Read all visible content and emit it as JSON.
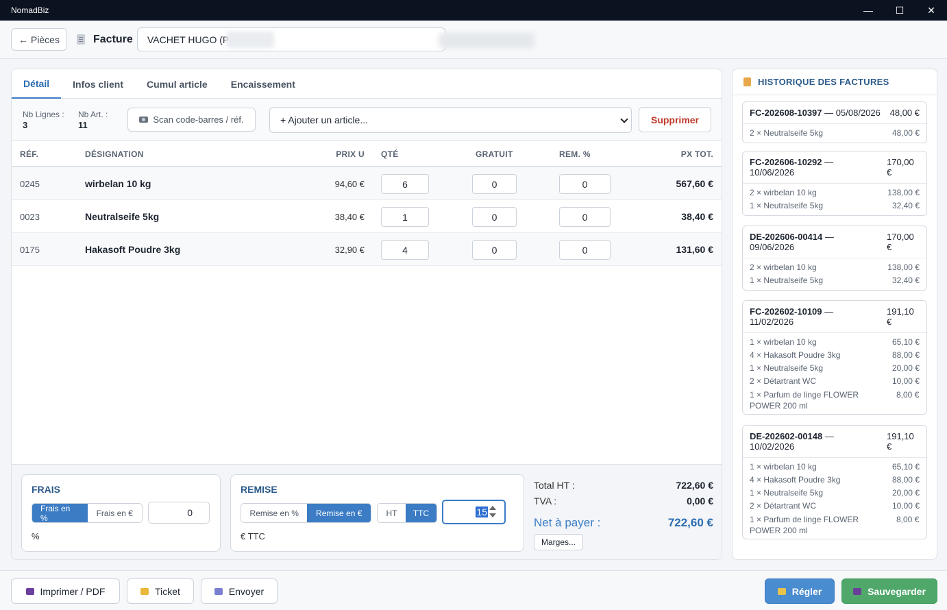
{
  "window": {
    "title": "NomadBiz",
    "minimize": "—",
    "maximize": "☐",
    "close": "✕"
  },
  "header": {
    "back_label": "← Pièces",
    "doc_type": "Facture",
    "client_value": "VACHET HUGO (PE"
  },
  "tabs": [
    "Détail",
    "Infos client",
    "Cumul article",
    "Encaissement"
  ],
  "toolbar": {
    "nb_lignes_label": "Nb Lignes :",
    "nb_lignes": "3",
    "nb_art_label": "Nb Art. :",
    "nb_art": "11",
    "scan_label": "Scan code-barres / réf.",
    "add_label": "+  Ajouter un article...",
    "delete_label": "Supprimer"
  },
  "table": {
    "headers": {
      "ref": "RÉF.",
      "designation": "DÉSIGNATION",
      "prix_u": "PRIX U",
      "qte": "QTÉ",
      "gratuit": "GRATUIT",
      "rem": "REM. %",
      "total": "PX TOT."
    },
    "rows": [
      {
        "ref": "0245",
        "designation": "wirbelan 10 kg",
        "prix_u": "94,60 €",
        "qte": "6",
        "gratuit": "0",
        "rem": "0",
        "total": "567,60 €"
      },
      {
        "ref": "0023",
        "designation": "Neutralseife 5kg",
        "prix_u": "38,40 €",
        "qte": "1",
        "gratuit": "0",
        "rem": "0",
        "total": "38,40 €"
      },
      {
        "ref": "0175",
        "designation": "Hakasoft Poudre 3kg",
        "prix_u": "32,90 €",
        "qte": "4",
        "gratuit": "0",
        "rem": "0",
        "total": "131,60 €"
      }
    ]
  },
  "frais": {
    "title": "FRAIS",
    "opt_pct": "Frais en %",
    "opt_eur": "Frais en €",
    "selected": "Frais en %",
    "value": "0",
    "unit": "%"
  },
  "remise": {
    "title": "REMISE",
    "opt_pct": "Remise en %",
    "opt_eur": "Remise en €",
    "selected": "Remise en €",
    "opt_ht": "HT",
    "opt_ttc": "TTC",
    "selected_tax": "TTC",
    "value": "15",
    "unit": "€ TTC"
  },
  "totals": {
    "ht_label": "Total HT :",
    "ht": "722,60 €",
    "tva_label": "TVA :",
    "tva": "0,00 €",
    "net_label": "Net à payer :",
    "net": "722,60 €",
    "marges_label": "Marges..."
  },
  "history": {
    "title": "HISTORIQUE DES FACTURES",
    "invoices": [
      {
        "num": "FC-202608-10397",
        "date": "05/08/2026",
        "amount": "48,00 €",
        "lines": [
          {
            "text": "2 × Neutralseife 5kg",
            "price": "48,00 €"
          }
        ]
      },
      {
        "num": "FC-202606-10292",
        "date": "10/06/2026",
        "amount": "170,00 €",
        "lines": [
          {
            "text": "2 × wirbelan 10 kg",
            "price": "138,00 €"
          },
          {
            "text": "1 × Neutralseife 5kg",
            "price": "32,40 €"
          }
        ]
      },
      {
        "num": "DE-202606-00414",
        "date": "09/06/2026",
        "amount": "170,00 €",
        "lines": [
          {
            "text": "2 × wirbelan 10 kg",
            "price": "138,00 €"
          },
          {
            "text": "1 × Neutralseife 5kg",
            "price": "32,40 €"
          }
        ]
      },
      {
        "num": "FC-202602-10109",
        "date": "11/02/2026",
        "amount": "191,10 €",
        "lines": [
          {
            "text": "1 × wirbelan 10 kg",
            "price": "65,10 €"
          },
          {
            "text": "4 × Hakasoft Poudre 3kg",
            "price": "88,00 €"
          },
          {
            "text": "1 × Neutralseife 5kg",
            "price": "20,00 €"
          },
          {
            "text": "2 × Détartrant WC",
            "price": "10,00 €"
          },
          {
            "text": "1 × Parfum de linge FLOWER POWER 200 ml",
            "price": "8,00 €"
          }
        ]
      },
      {
        "num": "DE-202602-00148",
        "date": "10/02/2026",
        "amount": "191,10 €",
        "lines": [
          {
            "text": "1 × wirbelan 10 kg",
            "price": "65,10 €"
          },
          {
            "text": "4 × Hakasoft Poudre 3kg",
            "price": "88,00 €"
          },
          {
            "text": "1 × Neutralseife 5kg",
            "price": "20,00 €"
          },
          {
            "text": "2 × Détartrant WC",
            "price": "10,00 €"
          },
          {
            "text": "1 × Parfum de linge FLOWER POWER 200 ml",
            "price": "8,00 €"
          }
        ]
      }
    ]
  },
  "footer": {
    "print_label": "Imprimer / PDF",
    "ticket_label": "Ticket",
    "send_label": "Envoyer",
    "pay_label": "Régler",
    "save_label": "Sauvegarder"
  },
  "colors": {
    "accent": "#3b7cc4",
    "danger": "#c0392b",
    "success": "#4fa86a",
    "titlebar": "#0b1220"
  }
}
